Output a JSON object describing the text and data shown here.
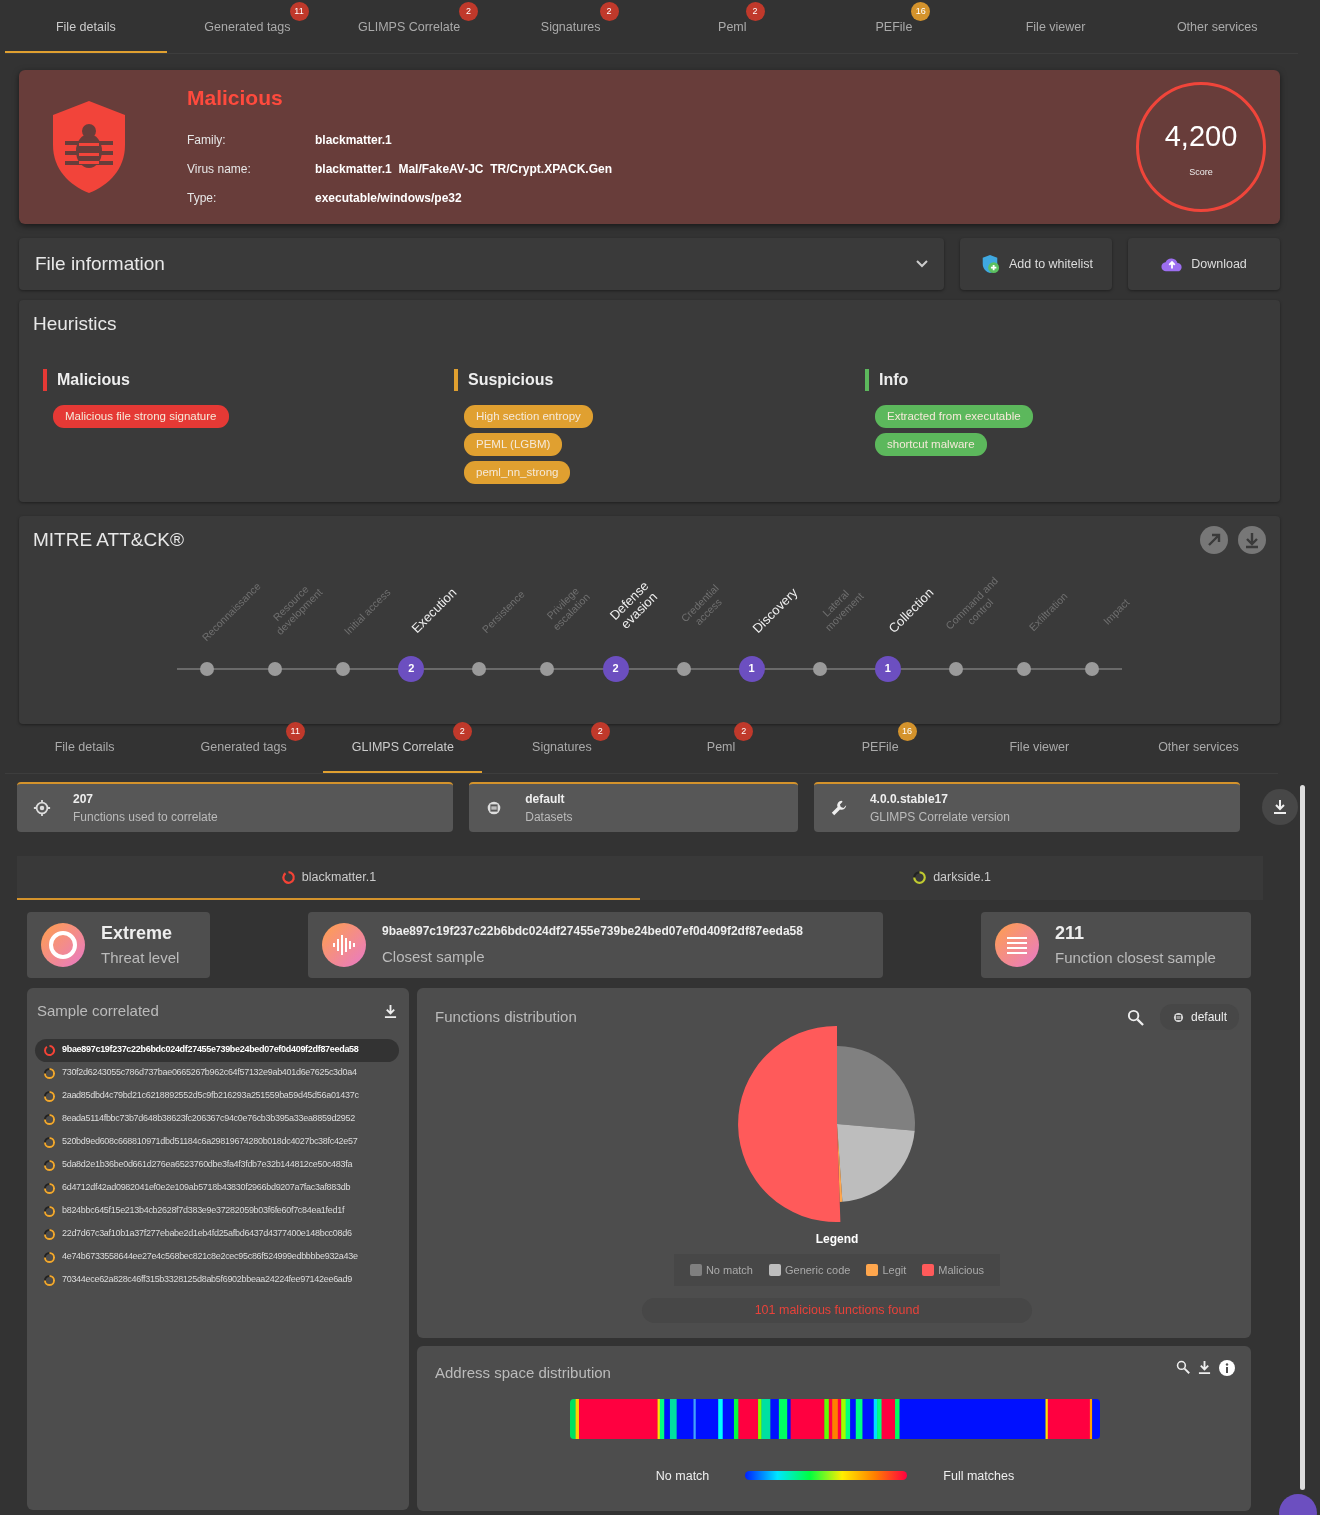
{
  "top_tabs": [
    {
      "label": "File details",
      "selected": true
    },
    {
      "label": "Generated tags",
      "selected": false,
      "badge": "11",
      "color": "#c0392b"
    },
    {
      "label": "GLIMPS Correlate",
      "selected": false,
      "badge": "2",
      "color": "#c0392b"
    },
    {
      "label": "Signatures",
      "selected": false,
      "badge": "2",
      "color": "#c0392b"
    },
    {
      "label": "Peml",
      "selected": false,
      "badge": "2",
      "color": "#c0392b"
    },
    {
      "label": "PEFile",
      "selected": false,
      "badge": "16",
      "color": "#d4932c"
    },
    {
      "label": "File viewer",
      "selected": false
    },
    {
      "label": "Other services",
      "selected": false
    }
  ],
  "verdict": {
    "title": "Malicious",
    "fields": [
      {
        "label": "Family:",
        "value": "blackmatter.1"
      },
      {
        "label": "Virus name:",
        "value": "blackmatter.1  Mal/FakeAV-JC  TR/Crypt.XPACK.Gen"
      },
      {
        "label": "Type:",
        "value": "executable/windows/pe32"
      }
    ],
    "score": "4,200",
    "score_label": "Score"
  },
  "file_information": {
    "title": "File information"
  },
  "actions": [
    {
      "label": "Add to whitelist",
      "kind": "whitelist"
    },
    {
      "label": "Download",
      "kind": "download"
    }
  ],
  "heuristics": {
    "title": "Heuristics",
    "groups": [
      {
        "title": "Malicious",
        "color": "#e53935",
        "tags": [
          "Malicious file strong signature"
        ]
      },
      {
        "title": "Suspicious",
        "color": "#e0a030",
        "tags": [
          "High section entropy",
          "PEML (LGBM)",
          "peml_nn_strong"
        ]
      },
      {
        "title": "Info",
        "color": "#5cb85c",
        "tags": [
          "Extracted from executable",
          "shortcut malware"
        ]
      }
    ]
  },
  "mitre": {
    "title": "MITRE ATT&CK®",
    "tactics": [
      {
        "label": "Reconnaissance"
      },
      {
        "label": "Resource development"
      },
      {
        "label": "Initial access"
      },
      {
        "label": "Execution",
        "count": "2"
      },
      {
        "label": "Persistence"
      },
      {
        "label": "Privilege escalation"
      },
      {
        "label": "Defense evasion",
        "count": "2"
      },
      {
        "label": "Credential access"
      },
      {
        "label": "Discovery",
        "count": "1"
      },
      {
        "label": "Lateral movement"
      },
      {
        "label": "Collection",
        "count": "1"
      },
      {
        "label": "Command and control"
      },
      {
        "label": "Exfiltration"
      },
      {
        "label": "Impact"
      }
    ]
  },
  "correlate_tabs": [
    {
      "label": "File details",
      "selected": false
    },
    {
      "label": "Generated tags",
      "selected": false,
      "badge": "11",
      "color": "#c0392b"
    },
    {
      "label": "GLIMPS Correlate",
      "selected": true,
      "badge": "2",
      "color": "#c0392b"
    },
    {
      "label": "Signatures",
      "selected": false,
      "badge": "2",
      "color": "#c0392b"
    },
    {
      "label": "Peml",
      "selected": false,
      "badge": "2",
      "color": "#c0392b"
    },
    {
      "label": "PEFile",
      "selected": false,
      "badge": "16",
      "color": "#d4932c"
    },
    {
      "label": "File viewer",
      "selected": false
    },
    {
      "label": "Other services",
      "selected": false
    }
  ],
  "info_cards": [
    {
      "kind": "target",
      "value": "207",
      "label": "Functions used to correlate"
    },
    {
      "kind": "dataset",
      "value": "default",
      "label": "Datasets"
    },
    {
      "kind": "wrench",
      "value": "4.0.0.stable17",
      "label": "GLIMPS Correlate version"
    }
  ],
  "sample_tabs": [
    {
      "label": "blackmatter.1",
      "selected": true,
      "color": "#f44336"
    },
    {
      "label": "darkside.1",
      "selected": false,
      "color": "#c0ca33"
    }
  ],
  "stats": [
    {
      "kind": "ring",
      "value": "Extreme",
      "label": "Threat level"
    },
    {
      "kind": "wave",
      "value": "9bae897c19f237c22b6bdc024df27455e739be24bed07ef0d409f2df87eeda58",
      "label": "Closest sample"
    },
    {
      "kind": "list",
      "value": "211",
      "label": "Function closest sample"
    }
  ],
  "sample_list": {
    "title": "Sample correlated",
    "items": [
      {
        "hash": "9bae897c19f237c22b6bdc024df27455e739be24bed07ef0d409f2df87eeda58",
        "selected": true
      },
      {
        "hash": "730f2d6243055c786d737bae0665267b962c64f57132e9ab401d6e7625c3d0a4",
        "selected": false
      },
      {
        "hash": "2aad85dbd4c79bd21c6218892552d5c9fb216293a251559ba59d45d56a01437c",
        "selected": false
      },
      {
        "hash": "8eada5114fbbc73b7d648b38623fc206367c94c0e76cb3b395a33ea8859d2952",
        "selected": false
      },
      {
        "hash": "520bd9ed608c668810971dbd51184c6a29819674280b018dc4027bc38fc42e57",
        "selected": false
      },
      {
        "hash": "5da8d2e1b36be0d661d276ea6523760dbe3fa4f3fdb7e32b144812ce50c483fa",
        "selected": false
      },
      {
        "hash": "6d4712df42ad0982041ef0e2e109ab5718b43830f2966bd9207a7fac3af883db",
        "selected": false
      },
      {
        "hash": "b824bbc645f15e213b4cb2628f7d383e9e37282059b03f6fe60f7c84ea1fed1f",
        "selected": false
      },
      {
        "hash": "22d7d67c3af10b1a37f277ebabe2d1eb4fd25afbd6437d4377400e148bcc08d6",
        "selected": false
      },
      {
        "hash": "4e74b6733558644ee27e4c568bec821c8e2cec95c86f524999edbbbbe932a43e",
        "selected": false
      },
      {
        "hash": "70344ece62a828c46ff315b3328125d8ab5f6902bbeaa24224fee97142ee6ad9",
        "selected": false
      }
    ]
  },
  "functions_distribution": {
    "title": "Functions distribution",
    "dataset": "default",
    "legend_title": "Legend",
    "legend": [
      {
        "label": "No match",
        "color": "#808080"
      },
      {
        "label": "Generic code",
        "color": "#bdbdbd"
      },
      {
        "label": "Legit",
        "color": "#ffa64d"
      },
      {
        "label": "Malicious",
        "color": "#ff5a5a"
      }
    ],
    "summary": "101 malicious functions found"
  },
  "address_space": {
    "title": "Address space distribution",
    "low_label": "No match",
    "high_label": "Full matches"
  }
}
